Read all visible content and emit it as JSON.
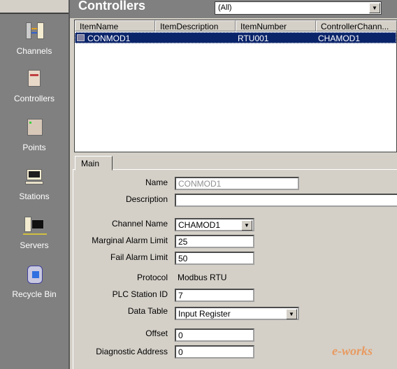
{
  "sidebar": {
    "items": [
      {
        "label": "Channels",
        "icon": "channels-icon"
      },
      {
        "label": "Controllers",
        "icon": "controllers-icon"
      },
      {
        "label": "Points",
        "icon": "points-icon"
      },
      {
        "label": "Stations",
        "icon": "stations-icon"
      },
      {
        "label": "Servers",
        "icon": "servers-icon"
      },
      {
        "label": "Recycle Bin",
        "icon": "recycle-bin-icon"
      }
    ]
  },
  "header": {
    "title": "Controllers",
    "filter": "(All)"
  },
  "list": {
    "columns": [
      "ItemName",
      "ItemDescription",
      "ItemNumber",
      "ControllerChann..."
    ],
    "rows": [
      {
        "name": "CONMOD1",
        "description": "",
        "number": "RTU001",
        "channel": "CHAMOD1"
      }
    ]
  },
  "tabs": [
    {
      "label": "Main"
    }
  ],
  "form": {
    "name_label": "Name",
    "name": "CONMOD1",
    "description_label": "Description",
    "description": "",
    "channel_label": "Channel Name",
    "channel": "CHAMOD1",
    "marginal_label": "Marginal Alarm Limit",
    "marginal": "25",
    "fail_label": "Fail Alarm Limit",
    "fail": "50",
    "protocol_label": "Protocol",
    "protocol": "Modbus RTU",
    "plc_label": "PLC Station ID",
    "plc": "7",
    "datatable_label": "Data Table",
    "datatable": "Input Register",
    "offset_label": "Offset",
    "offset": "0",
    "diag_label": "Diagnostic Address",
    "diag": "0"
  },
  "watermark": "e-works"
}
